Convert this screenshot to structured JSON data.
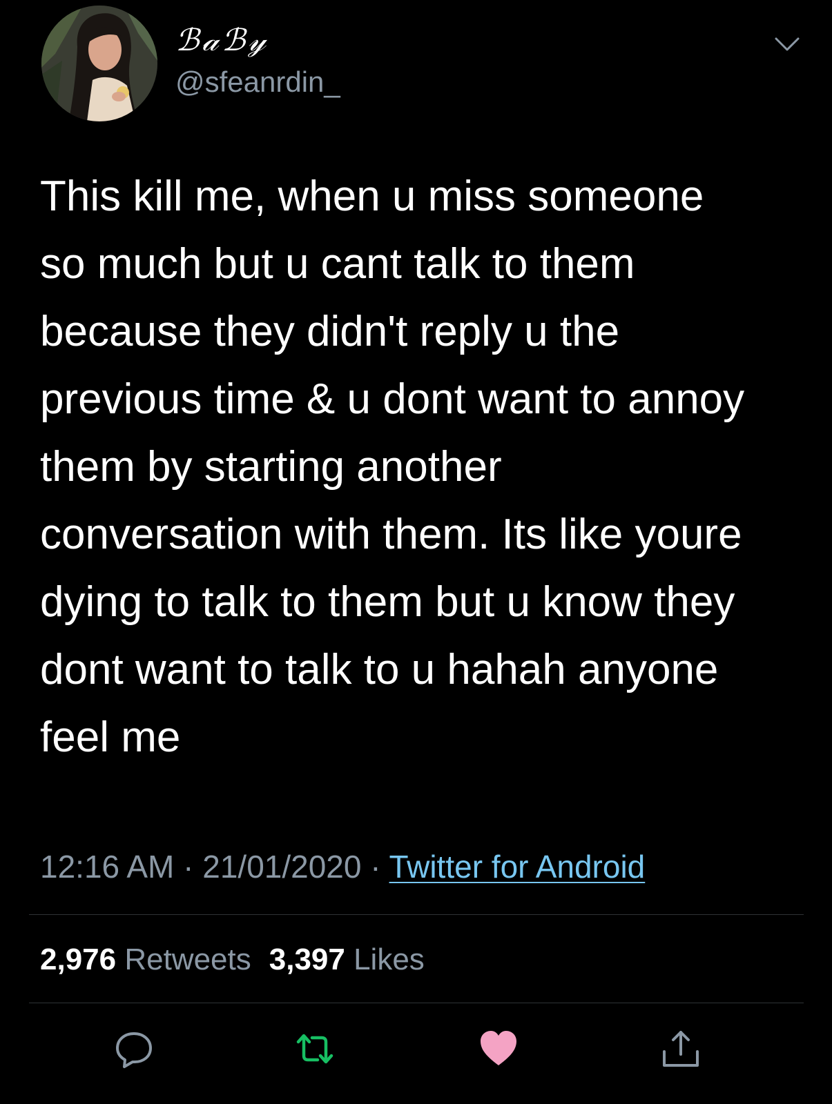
{
  "user": {
    "display_name": "ℬ𝒶ℬ𝓎",
    "handle": "@sfeanrdin_"
  },
  "tweet": {
    "lines": [
      "This kill me, when u miss someone",
      "so much but u cant talk to them",
      "because they didn't reply u the",
      "previous time & u dont want to annoy",
      "them by starting another",
      "conversation with them. Its like youre",
      "dying to talk to them but u know they",
      "dont want to talk to u hahah anyone",
      "feel me"
    ],
    "time": "12:16 AM",
    "separator": " · ",
    "date": "21/01/2020",
    "source": "Twitter for Android"
  },
  "stats": {
    "retweets_count": "2,976",
    "retweets_label": " Retweets",
    "likes_count": "3,397",
    "likes_label": " Likes"
  },
  "icons": {
    "menu": "chevron-down-icon",
    "reply": "reply-bubble-icon",
    "retweet": "retweet-icon",
    "like": "heart-icon",
    "share": "share-icon"
  },
  "colors": {
    "background": "#000000",
    "text": "#ffffff",
    "secondary": "#8b98a5",
    "link": "#78c6f0",
    "retweet": "#17bf63",
    "like": "#f4a3c4",
    "divider": "#2f3336"
  }
}
